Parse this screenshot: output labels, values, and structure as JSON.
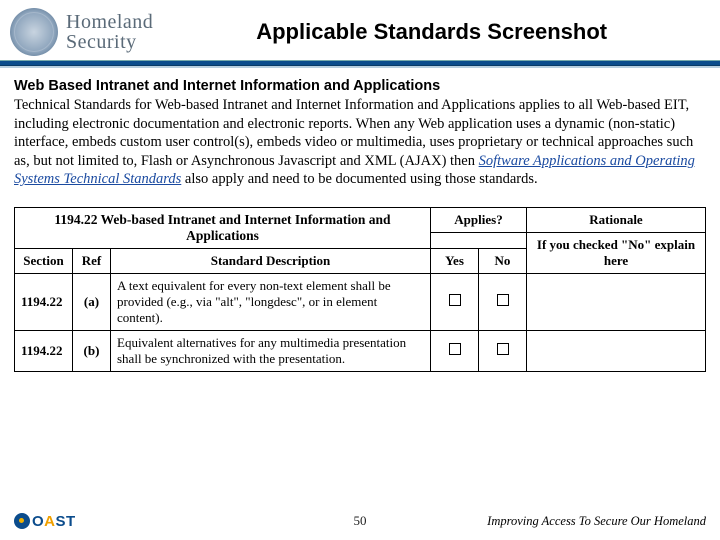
{
  "header": {
    "dept_line1": "Homeland",
    "dept_line2": "Security",
    "slide_title": "Applicable Standards Screenshot"
  },
  "section": {
    "title": "Web Based Intranet and Internet Information and Applications",
    "body_pre": "Technical Standards for Web-based Intranet and Internet Information and Applications applies to all Web-based EIT, including electronic documentation and electronic reports. When any Web application uses a dynamic (non-static) interface, embeds custom user control(s), embeds video or multimedia, uses proprietary or technical approaches such as, but not limited to, Flash or Asynchronous Javascript and XML (AJAX) then ",
    "body_link": "Software Applications and Operating Systems Technical Standards",
    "body_post": " also apply and need to be documented using those standards."
  },
  "table": {
    "title": "1194.22 Web-based Intranet and Internet Information and Applications",
    "applies_hdr": "Applies?",
    "rationale_hdr": "Rationale",
    "rationale_sub": "If you checked \"No\" explain here",
    "col_section": "Section",
    "col_ref": "Ref",
    "col_desc": "Standard Description",
    "col_yes": "Yes",
    "col_no": "No",
    "rows": [
      {
        "section": "1194.22",
        "ref": "(a)",
        "desc": "A text equivalent for every non-text element shall be provided (e.g., via \"alt\", \"longdesc\", or in element content)."
      },
      {
        "section": "1194.22",
        "ref": "(b)",
        "desc": "Equivalent alternatives for any multimedia presentation shall be synchronized with the presentation."
      }
    ]
  },
  "footer": {
    "logo_a": "A",
    "logo_rest": "ST",
    "logo_o": "O",
    "page": "50",
    "tagline": "Improving Access To Secure Our Homeland"
  }
}
